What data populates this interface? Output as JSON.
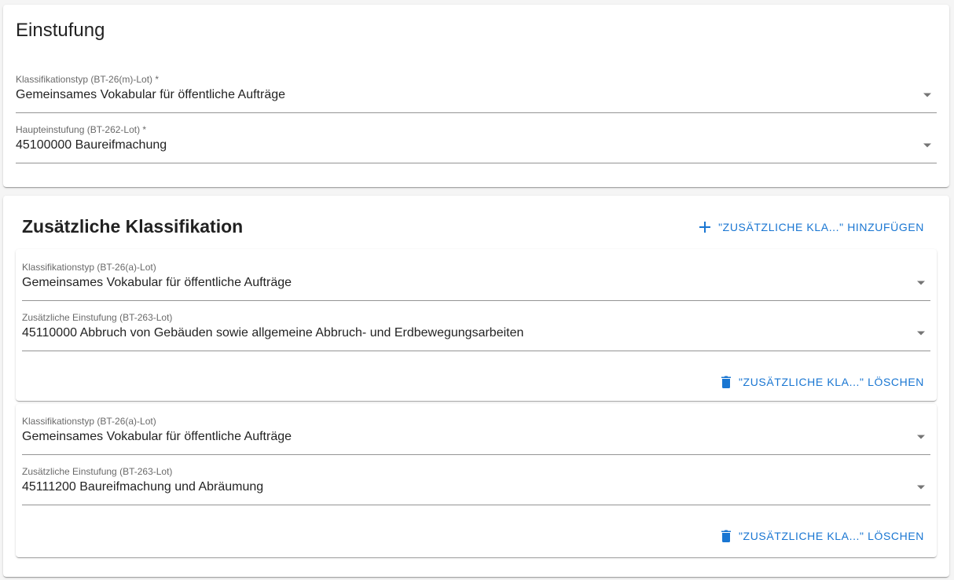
{
  "einstufung": {
    "title": "Einstufung",
    "fields": [
      {
        "label": "Klassifikationstyp (BT-26(m)-Lot) *",
        "value": "Gemeinsames Vokabular für öffentliche Aufträge"
      },
      {
        "label": "Haupteinstufung (BT-262-Lot) *",
        "value": "45100000 Baureifmachung"
      }
    ]
  },
  "zusaetzlich": {
    "title": "Zusätzliche Klassifikation",
    "add_label": "\"ZUSÄTZLICHE KLA...\" HINZUFÜGEN",
    "items": [
      {
        "type_label": "Klassifikationstyp (BT-26(a)-Lot)",
        "type_value": "Gemeinsames Vokabular für öffentliche Aufträge",
        "class_label": "Zusätzliche Einstufung (BT-263-Lot)",
        "class_value": "45110000 Abbruch von Gebäuden sowie allgemeine Abbruch- und Erdbewegungsarbeiten",
        "delete_label": "\"ZUSÄTZLICHE KLA...\" LÖSCHEN"
      },
      {
        "type_label": "Klassifikationstyp (BT-26(a)-Lot)",
        "type_value": "Gemeinsames Vokabular für öffentliche Aufträge",
        "class_label": "Zusätzliche Einstufung (BT-263-Lot)",
        "class_value": "45111200 Baureifmachung und Abräumung",
        "delete_label": "\"ZUSÄTZLICHE KLA...\" LÖSCHEN"
      }
    ]
  },
  "colors": {
    "accent": "#1976d2",
    "background": "#f5f5f5"
  },
  "icons": {
    "dropdown": "arrow-drop-down-icon",
    "add": "plus-icon",
    "delete": "trash-icon"
  }
}
